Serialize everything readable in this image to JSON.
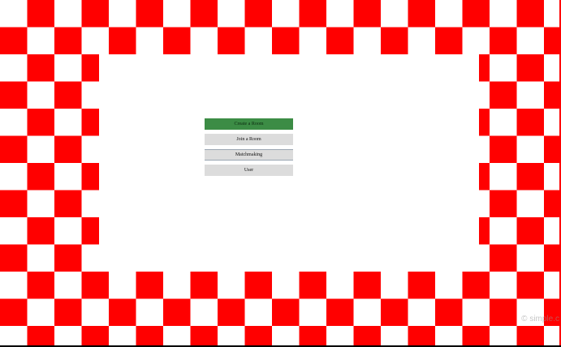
{
  "theme": {
    "checker_color": "#ff0000",
    "background": "#ffffff",
    "primary_button": "#3c8c45",
    "button": "#dcdcdc"
  },
  "menu": {
    "items": [
      {
        "label": "Create a Room",
        "style": "primary"
      },
      {
        "label": "Join a Room",
        "style": "default"
      },
      {
        "label": "Matchmaking",
        "style": "outlined"
      },
      {
        "label": "User",
        "style": "default"
      }
    ]
  },
  "watermark": {
    "text": "© simple.c"
  }
}
